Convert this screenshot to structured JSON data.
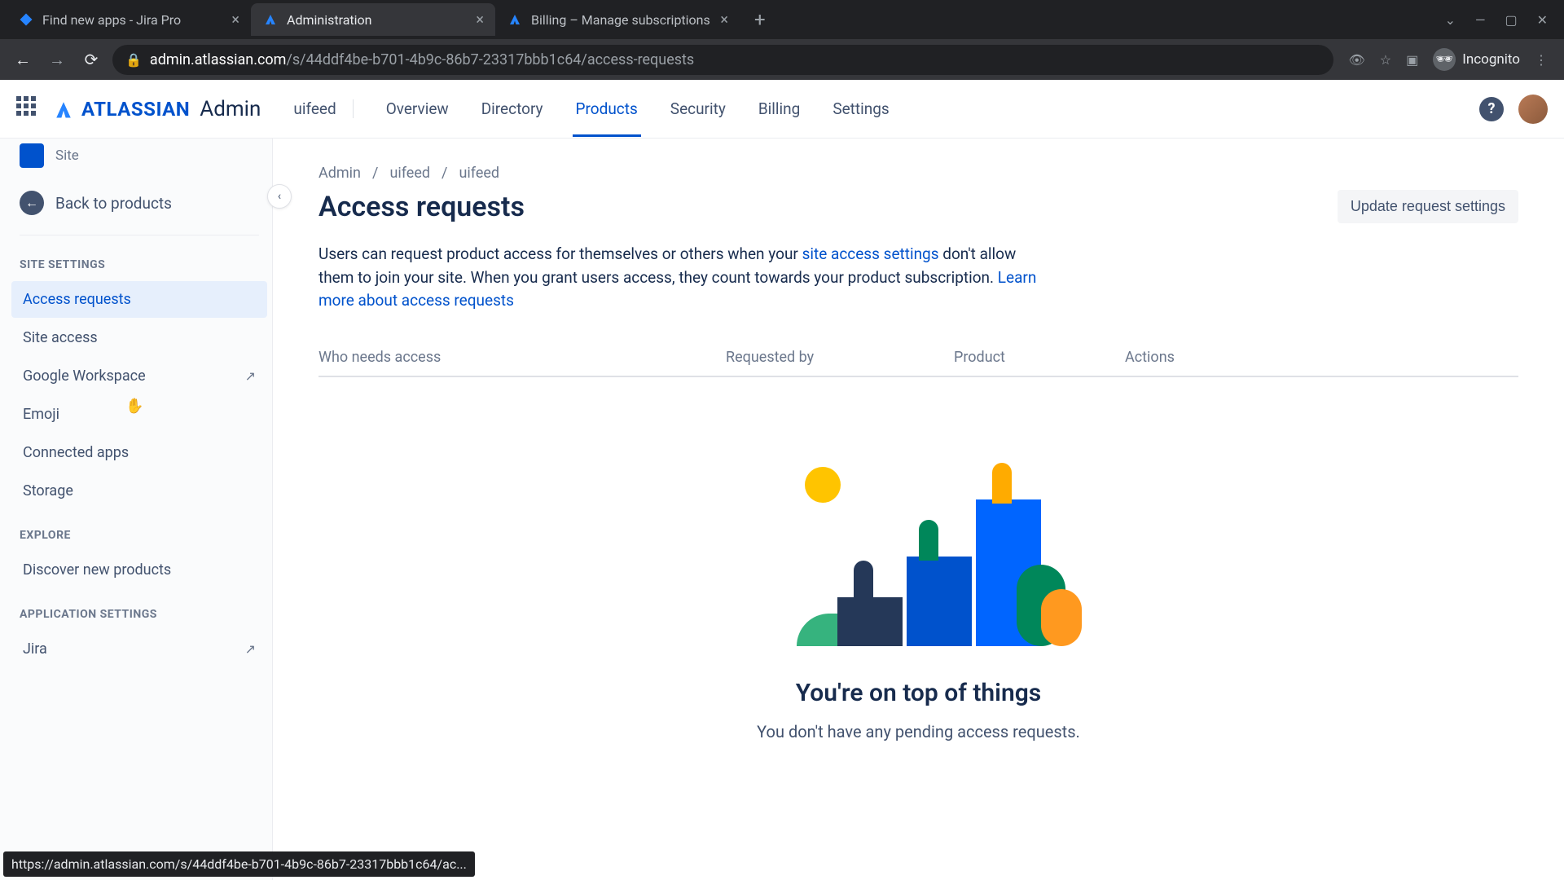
{
  "browser": {
    "tabs": [
      {
        "title": "Find new apps - Jira Pro",
        "active": false
      },
      {
        "title": "Administration",
        "active": true
      },
      {
        "title": "Billing – Manage subscriptions",
        "active": false
      }
    ],
    "url_host": "admin.atlassian.com",
    "url_path": "/s/44ddf4be-b701-4b9c-86b7-23317bbb1c64/access-requests",
    "incognito_label": "Incognito",
    "status_url": "https://admin.atlassian.com/s/44ddf4be-b701-4b9c-86b7-23317bbb1c64/ac..."
  },
  "header": {
    "brand": "ATLASSIAN",
    "admin_label": "Admin",
    "org_name": "uifeed",
    "nav": [
      "Overview",
      "Directory",
      "Products",
      "Security",
      "Billing",
      "Settings"
    ],
    "active_nav_index": 2
  },
  "sidebar": {
    "site_label": "Site",
    "back_label": "Back to products",
    "sections": [
      {
        "heading": "SITE SETTINGS",
        "items": [
          {
            "label": "Access requests",
            "active": true,
            "external": false
          },
          {
            "label": "Site access",
            "active": false,
            "external": false
          },
          {
            "label": "Google Workspace",
            "active": false,
            "external": true
          },
          {
            "label": "Emoji",
            "active": false,
            "external": false
          },
          {
            "label": "Connected apps",
            "active": false,
            "external": false
          },
          {
            "label": "Storage",
            "active": false,
            "external": false
          }
        ]
      },
      {
        "heading": "EXPLORE",
        "items": [
          {
            "label": "Discover new products",
            "active": false,
            "external": false
          }
        ]
      },
      {
        "heading": "APPLICATION SETTINGS",
        "items": [
          {
            "label": "Jira",
            "active": false,
            "external": true
          }
        ]
      }
    ]
  },
  "main": {
    "breadcrumb": [
      "Admin",
      "uifeed",
      "uifeed"
    ],
    "title": "Access requests",
    "action_button": "Update request settings",
    "description_pre": "Users can request product access for themselves or others when your ",
    "description_link1": "site access settings",
    "description_mid": " don't allow them to join your site. When you grant users access, they count towards your product subscription. ",
    "description_link2": "Learn more about access requests",
    "columns": [
      "Who needs access",
      "Requested by",
      "Product",
      "Actions"
    ],
    "empty_title": "You're on top of things",
    "empty_text": "You don't have any pending access requests."
  }
}
